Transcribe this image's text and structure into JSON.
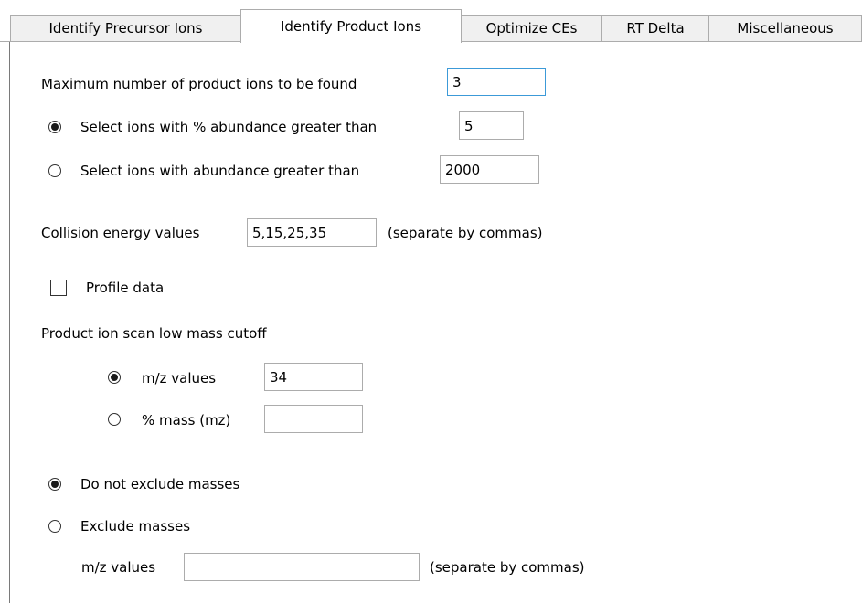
{
  "tabs": [
    {
      "label": "Identify Precursor Ions",
      "selected": false
    },
    {
      "label": "Identify Product Ions",
      "selected": true
    },
    {
      "label": "Optimize CEs",
      "selected": false
    },
    {
      "label": "RT Delta",
      "selected": false
    },
    {
      "label": "Miscellaneous",
      "selected": false
    }
  ],
  "max_product_ions": {
    "label": "Maximum number of product ions to be found",
    "value": "3"
  },
  "selection_mode": {
    "percent_option": {
      "label": "Select ions with % abundance greater than",
      "value": "5",
      "checked": true
    },
    "absolute_option": {
      "label": "Select ions with abundance greater than",
      "value": "2000",
      "checked": false
    }
  },
  "collision_energy": {
    "label": "Collision energy values",
    "value": "5,15,25,35",
    "hint": "(separate by commas)"
  },
  "profile_data": {
    "label": "Profile data",
    "checked": false
  },
  "low_mass_cutoff": {
    "heading": "Product ion scan low mass cutoff",
    "mz_option": {
      "label": "m/z values",
      "value": "34",
      "checked": true
    },
    "percent_option": {
      "label": "% mass (mz)",
      "value": "",
      "checked": false
    }
  },
  "exclusion": {
    "no_exclude_option": {
      "label": "Do not exclude masses",
      "checked": true
    },
    "exclude_option": {
      "label": "Exclude masses",
      "checked": false
    },
    "mz_label": "m/z values",
    "mz_value": "",
    "hint": "(separate by commas)"
  }
}
